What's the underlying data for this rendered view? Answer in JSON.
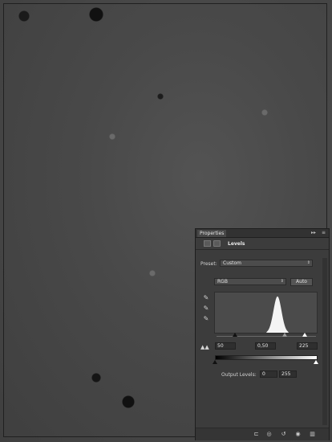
{
  "panel": {
    "tab_label": "Properties",
    "collapse_glyph": "▸▸",
    "menu_glyph": "≡",
    "adjustment_name": "Levels",
    "preset": {
      "label": "Preset:",
      "value": "Custom"
    },
    "channel": {
      "value": "RGB"
    },
    "auto_label": "Auto",
    "inputs": {
      "black": "50",
      "gamma": "0,50",
      "white": "225"
    },
    "output": {
      "label": "Output Levels:",
      "black": "0",
      "white": "255"
    },
    "histogram_peak_fraction": 0.62
  },
  "icons": {
    "levels": "levels-icon",
    "mask": "mask-icon",
    "eyedropper_black": "eyedropper-black-icon",
    "eyedropper_gray": "eyedropper-gray-icon",
    "eyedropper_white": "eyedropper-white-icon",
    "clip": "clip-to-layer-icon",
    "view_previous": "view-previous-icon",
    "reset": "reset-icon",
    "visibility": "eye-icon",
    "delete": "trash-icon"
  }
}
